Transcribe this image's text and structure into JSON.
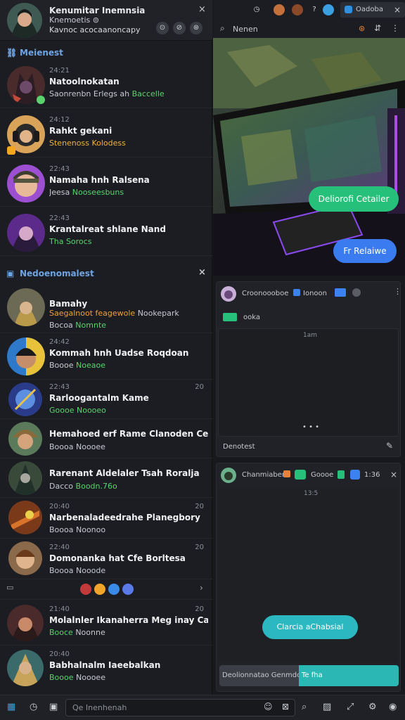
{
  "profile": {
    "title": "Kenumitar Inemnsia",
    "subtitle": "Knemoetis ⊜",
    "status": "Kavnoc acocaanoncapy",
    "close": "×",
    "actions": [
      "⊙",
      "⊘",
      "⊛"
    ]
  },
  "sections": {
    "favorites": {
      "label": "Meienest",
      "icon": "⛓"
    },
    "recommended": {
      "label": "Nedoenomalest",
      "icon": "▣",
      "close": "×"
    }
  },
  "chats_top": [
    {
      "time": "24:21",
      "name": "Natoolnokatan",
      "message": "Saonrenbn Erlegs ah",
      "extra": "Baccelle",
      "count": ""
    },
    {
      "time": "24:12",
      "name": "Rahkt gekani",
      "message": "Stenenoss Kolodess",
      "extra": "",
      "count": ""
    },
    {
      "time": "22:43",
      "name": "Namaha hnh Ralsena",
      "message": "Jeesa",
      "extra": "Nooseesbuns",
      "count": ""
    },
    {
      "time": "22:43",
      "name": "Krantalreat shlane Nand",
      "message": "Tha",
      "extra": "Sorocs",
      "count": ""
    }
  ],
  "chats_bottom": [
    {
      "time": "",
      "name": "Bamahy",
      "message": "Saegalnoot feagewole",
      "extra": "Nookepark",
      "sub": "Bocoa",
      "sub_green": "Nomnte",
      "count": ""
    },
    {
      "time": "24:42",
      "name": "Kommah hnh Uadse Roqdoan",
      "message": "",
      "sub": "Boooe",
      "sub_green": "Noeaoe",
      "count": ""
    },
    {
      "time": "22:43",
      "name": "Rarloogantalm Kame",
      "message": "",
      "sub": "Goooe",
      "sub_green": "Noooeo",
      "count": "20"
    },
    {
      "time": "",
      "name": "Hemahoed erf Rame Clanoden Cenainy",
      "message": "",
      "sub": "Boooa",
      "sub_green": "Noooee",
      "count": ""
    },
    {
      "time": "",
      "name": "Rarenant Aldelaler Tsah Roralja",
      "message": "",
      "sub": "Dacco",
      "sub_green": "Boodn.76o",
      "count": ""
    },
    {
      "time": "20:40",
      "name": "Narbenaladeedrahe Planegbory",
      "message": "",
      "sub": "Boooa",
      "sub_green": "Noonoo",
      "count": "20"
    },
    {
      "time": "22:40",
      "name": "Domonanka hat Cfe Borltesa",
      "message": "",
      "sub": "Boooa",
      "sub_green": "Nooode",
      "count": "20"
    },
    {
      "time": "21:40",
      "name": "Molalnler Ikanaherra Meg inay Canarg",
      "message": "",
      "sub": "Booce",
      "sub_green": "Noonne",
      "count": "20"
    },
    {
      "time": "20:40",
      "name": "Babhalnalm Iaeebalkan",
      "message": "",
      "sub": "Boooe",
      "sub_green": "Noooee",
      "count": ""
    }
  ],
  "topbar": {
    "tab_label": "Oadoba",
    "close": "×"
  },
  "search": {
    "placeholder": "Nenen"
  },
  "video": {
    "bubble1": "Deliorofi Cetailer",
    "bubble2": "Fr Relaiwe"
  },
  "card1": {
    "title": "Croonoooboe",
    "tag": "Ionoon",
    "chip": "ooka",
    "time": "1am",
    "footer": "Denotest",
    "dots": "• • •"
  },
  "card2": {
    "title": "Chanmiaber",
    "tag": "Goooe",
    "time": "1:36",
    "inner_time": "13:5",
    "cta": "Clarcia aChabsial",
    "bar_left": "Deolionnatao Genmdoo",
    "bar_right": "Te fha"
  },
  "bottom": {
    "placeholder": "Qe Inenhenah"
  },
  "colors": {
    "accent": "#2bb8b5",
    "green": "#5bd36d",
    "blue": "#3a82f0",
    "link": "#6fa4e3"
  }
}
